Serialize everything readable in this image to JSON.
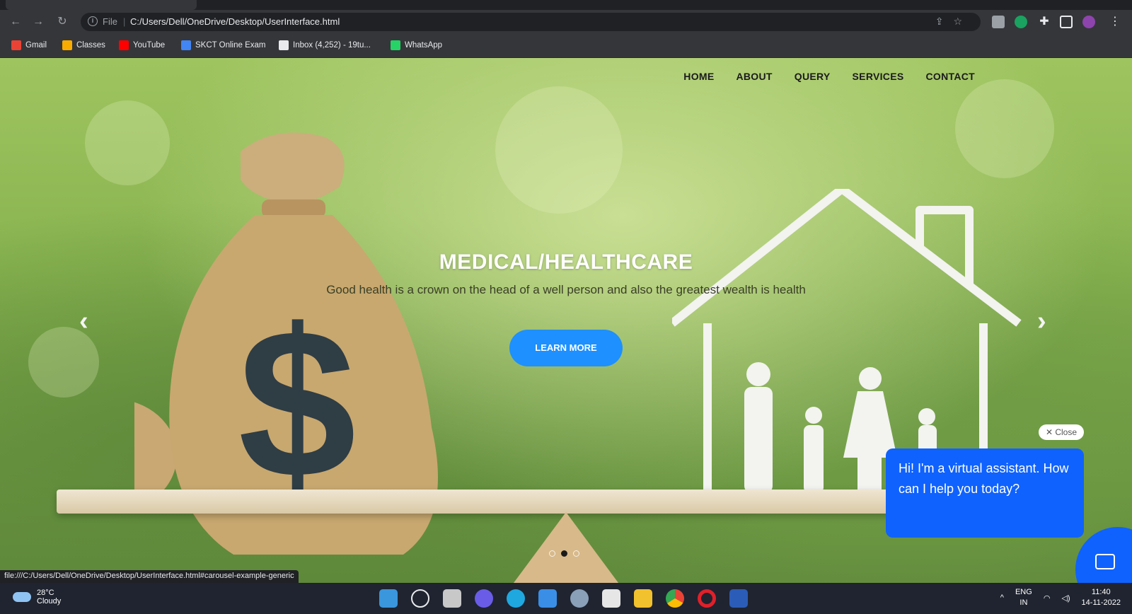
{
  "browser": {
    "address": {
      "scheme_label": "File",
      "url": "C:/Users/Dell/OneDrive/Desktop/UserInterface.html"
    },
    "bookmarks": [
      {
        "label": "Gmail",
        "icon": "gmail-icon",
        "color": "#ea4335"
      },
      {
        "label": "Classes",
        "icon": "classroom-icon",
        "color": "#f9ab00"
      },
      {
        "label": "YouTube",
        "icon": "youtube-icon",
        "color": "#ff0000"
      },
      {
        "label": "SKCT Online Exam",
        "icon": "exam-icon",
        "color": "#4285f4"
      },
      {
        "label": "Inbox (4,252) - 19tu...",
        "icon": "chrome-icon",
        "color": "#e8eaed"
      },
      {
        "label": "WhatsApp",
        "icon": "whatsapp-icon",
        "color": "#25d366"
      }
    ],
    "status_url": "file:///C:/Users/Dell/OneDrive/Desktop/UserInterface.html#carousel-example-generic"
  },
  "site": {
    "nav": [
      "HOME",
      "ABOUT",
      "QUERY",
      "SERVICES",
      "CONTACT"
    ],
    "hero": {
      "title": "MEDICAL/HEALTHCARE",
      "subtitle": "Good health is a crown on the head of a well person and also the greatest wealth is health",
      "button": "LEARN MORE",
      "bag_symbol": "$",
      "active_slide": 2,
      "slide_count": 3
    },
    "chat": {
      "close_label": "✕ Close",
      "message": "Hi! I'm a virtual assistant. How can I help you today?"
    }
  },
  "taskbar": {
    "weather_temp": "28°C",
    "weather_text": "Cloudy",
    "language": "ENG",
    "region": "IN",
    "time": "11:40",
    "date": "14-11-2022"
  },
  "colors": {
    "accent": "#1e90ff",
    "chat": "#0f62fe",
    "chrome_bg": "#35363a"
  }
}
